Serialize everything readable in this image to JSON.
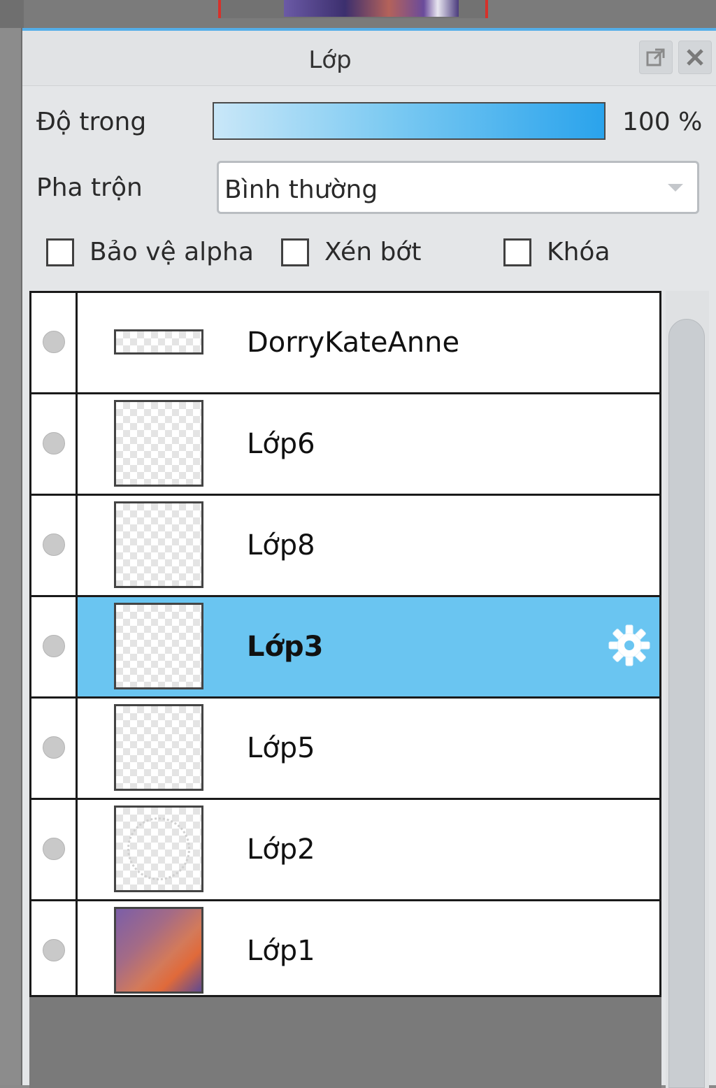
{
  "panel": {
    "title": "Lớp"
  },
  "opacity": {
    "label": "Độ trong",
    "value_text": "100 %",
    "value_fraction": 1.0
  },
  "blend": {
    "label": "Pha trộn",
    "selected": "Bình thường"
  },
  "checkboxes": [
    {
      "label": "Bảo vệ alpha",
      "checked": false
    },
    {
      "label": "Xén bớt",
      "checked": false
    },
    {
      "label": "Khóa",
      "checked": false
    }
  ],
  "layers": [
    {
      "name": "DorryKateAnne",
      "thumb": "text-layer",
      "selected": false
    },
    {
      "name": "Lớp6",
      "thumb": "transparent",
      "selected": false
    },
    {
      "name": "Lớp8",
      "thumb": "transparent",
      "selected": false
    },
    {
      "name": "Lớp3",
      "thumb": "transparent",
      "selected": true,
      "icon": "gear-icon"
    },
    {
      "name": "Lớp5",
      "thumb": "transparent",
      "selected": false
    },
    {
      "name": "Lớp2",
      "thumb": "circle",
      "selected": false
    },
    {
      "name": "Lớp1",
      "thumb": "photo",
      "selected": false
    }
  ],
  "icons": {
    "popout": "external-window-icon",
    "close": "close-icon"
  },
  "colors": {
    "accent": "#54aee9",
    "selected_row": "#6ac5f1"
  }
}
